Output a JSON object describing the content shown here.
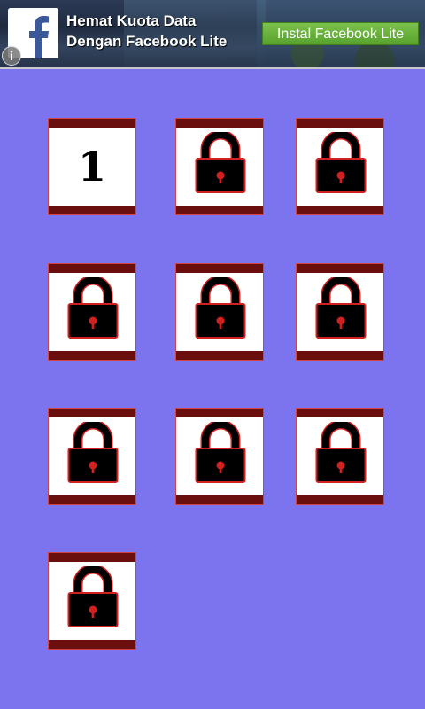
{
  "ad": {
    "line1": "Hemat Kuota Data",
    "line2": "Dengan Facebook Lite",
    "cta": "Instal Facebook Lite",
    "logo_icon": "facebook-logo-icon",
    "info_icon": "info-icon"
  },
  "levels": [
    {
      "label": "1",
      "locked": false
    },
    {
      "label": "",
      "locked": true
    },
    {
      "label": "",
      "locked": true
    },
    {
      "label": "",
      "locked": true
    },
    {
      "label": "",
      "locked": true
    },
    {
      "label": "",
      "locked": true
    },
    {
      "label": "",
      "locked": true
    },
    {
      "label": "",
      "locked": true
    },
    {
      "label": "",
      "locked": true
    },
    {
      "label": "",
      "locked": true
    }
  ],
  "colors": {
    "background": "#7b74ee",
    "tile_bar": "#6b0e0e",
    "lock_body": "#000000",
    "lock_outline": "#d12020",
    "cta_green": "#57a22d"
  }
}
